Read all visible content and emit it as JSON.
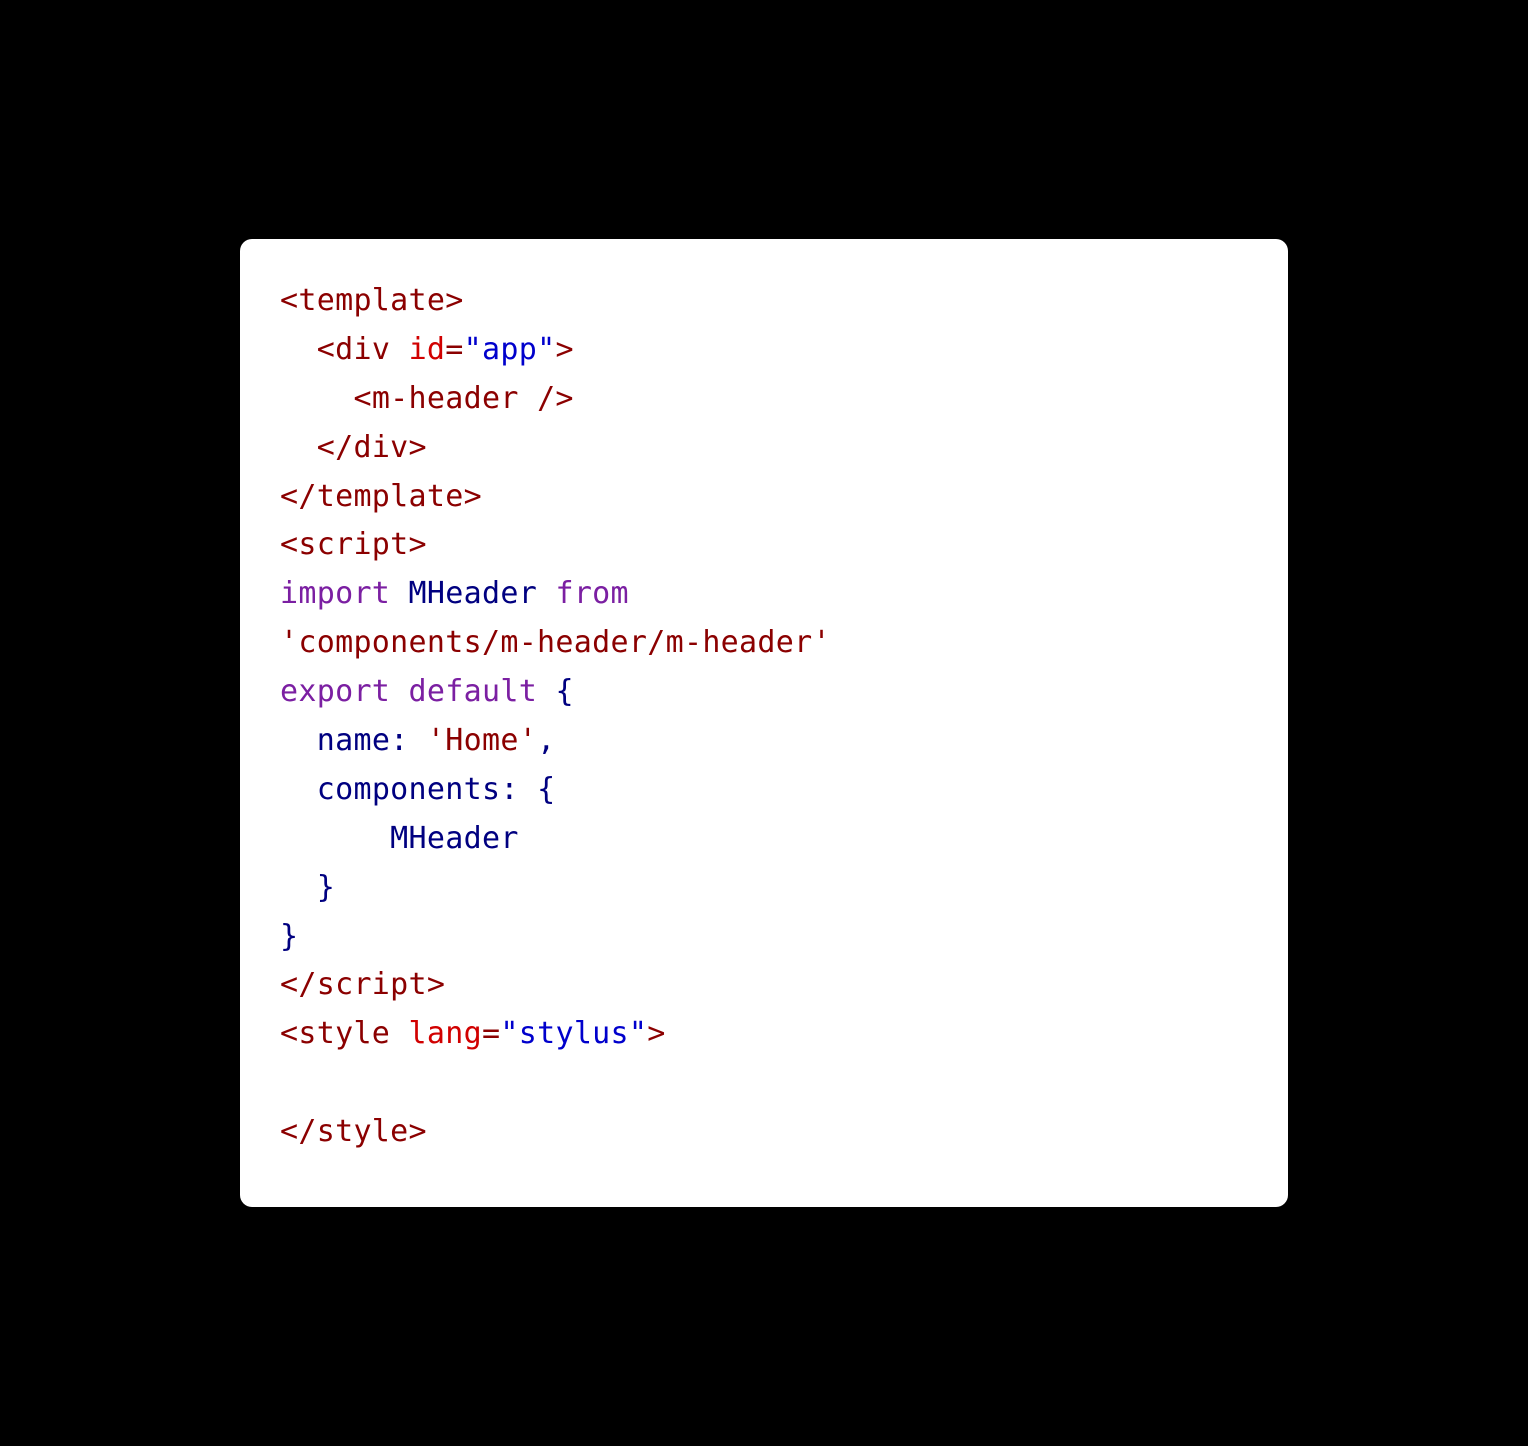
{
  "code": {
    "line1": {
      "tag_open": "<template>"
    },
    "line2": {
      "indent": "  ",
      "tag_open": "<div",
      "space": " ",
      "attr_name": "id",
      "equals": "=",
      "attr_value": "\"app\"",
      "tag_close": ">"
    },
    "line3": {
      "indent": "    ",
      "tag": "<m-header />"
    },
    "line4": {
      "indent": "  ",
      "tag": "</div>"
    },
    "line5": {
      "tag": "</template>"
    },
    "line6": {
      "tag": "<script>"
    },
    "line7": {
      "kw_import": "import",
      "s1": " ",
      "ident": "MHeader",
      "s2": " ",
      "kw_from": "from",
      "s3": " "
    },
    "line8": {
      "string": "'components/m-header/m-header'"
    },
    "line9": {
      "kw_export": "export",
      "s1": " ",
      "kw_default": "default",
      "s2": " ",
      "brace": "{"
    },
    "line10": {
      "indent": "  ",
      "prop": "name:",
      "s1": " ",
      "string": "'Home'",
      "comma": ","
    },
    "line11": {
      "indent": "  ",
      "prop": "components:",
      "s1": " ",
      "brace": "{"
    },
    "line12": {
      "indent": "      ",
      "ident": "MHeader"
    },
    "line13": {
      "indent": "  ",
      "brace": "}"
    },
    "line14": {
      "brace": "}"
    },
    "line15": {
      "tag": "</script>"
    },
    "line16": {
      "tag_open": "<style",
      "s1": " ",
      "attr_name": "lang",
      "equals": "=",
      "attr_value": "\"stylus\"",
      "tag_close": ">"
    },
    "line17": {
      "blank": ""
    },
    "line18": {
      "tag": "</style>"
    }
  }
}
